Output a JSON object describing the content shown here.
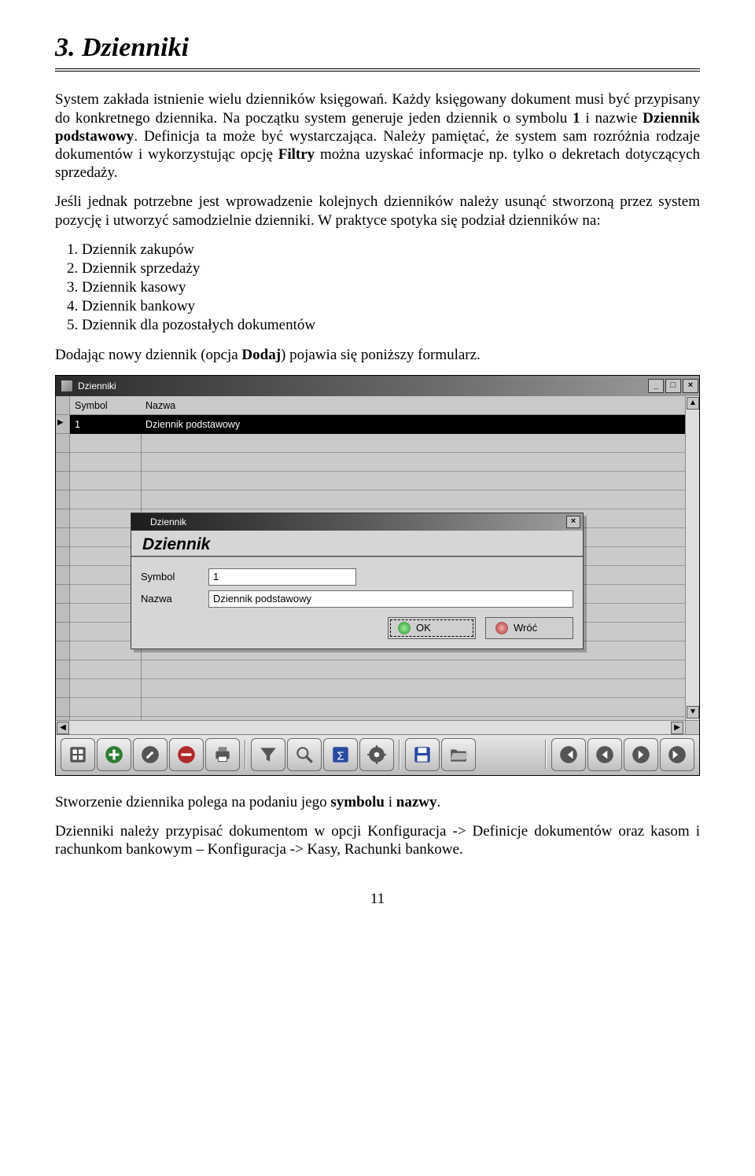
{
  "heading": "3.   Dzienniki",
  "p1_parts": {
    "a": "System zakłada istnienie wielu dzienników księgowań. Każdy księgowany dokument musi być przypisany do konkretnego dziennika. Na początku system generuje jeden dziennik o symbolu ",
    "b": "1",
    "c": " i nazwie ",
    "d": "Dziennik podstawowy",
    "e": ". Definicja ta może być wystarczająca. Należy pamiętać, że system sam rozróżnia rodzaje dokumentów i wykorzystując opcję ",
    "f": "Filtry",
    "g": " można uzyskać informacje np. tylko o dekretach dotyczących sprzedaży."
  },
  "p2": "Jeśli jednak potrzebne jest  wprowadzenie kolejnych dzienników należy usunąć stworzoną przez system pozycję i utworzyć samodzielnie dzienniki. W praktyce spotyka się podział dzienników na:",
  "list": [
    "Dziennik zakupów",
    "Dziennik sprzedaży",
    "Dziennik kasowy",
    "Dziennik bankowy",
    "Dziennik dla pozostałych dokumentów"
  ],
  "p3_parts": {
    "a": "Dodając nowy dziennik (opcja ",
    "b": "Dodaj",
    "c": ") pojawia się poniższy formularz."
  },
  "screenshot": {
    "window": {
      "title": "Dzienniki",
      "btn_min": "_",
      "btn_max": "□",
      "btn_close": "×"
    },
    "grid": {
      "col_symbol": "Symbol",
      "col_nazwa": "Nazwa",
      "row_symbol": "1",
      "row_nazwa": "Dziennik podstawowy"
    },
    "scroll": {
      "up": "▲",
      "down": "▼",
      "left": "◀",
      "right": "▶"
    },
    "dialog": {
      "title": "Dziennik",
      "header_word": "Dziennik",
      "label_symbol": "Symbol",
      "label_nazwa": "Nazwa",
      "value_symbol": "1",
      "value_nazwa": "Dziennik podstawowy",
      "ok_label": "OK",
      "back_label": "Wróć",
      "close": "×"
    }
  },
  "p4_parts": {
    "a": "Stworzenie dziennika polega na podaniu jego ",
    "b": "symbolu",
    "c": " i ",
    "d": "nazwy",
    "e": "."
  },
  "p5": "Dzienniki należy przypisać dokumentom w opcji Konfiguracja -> Definicje dokumentów oraz kasom i rachunkom bankowym – Konfiguracja -> Kasy, Rachunki bankowe.",
  "page_number": "11"
}
